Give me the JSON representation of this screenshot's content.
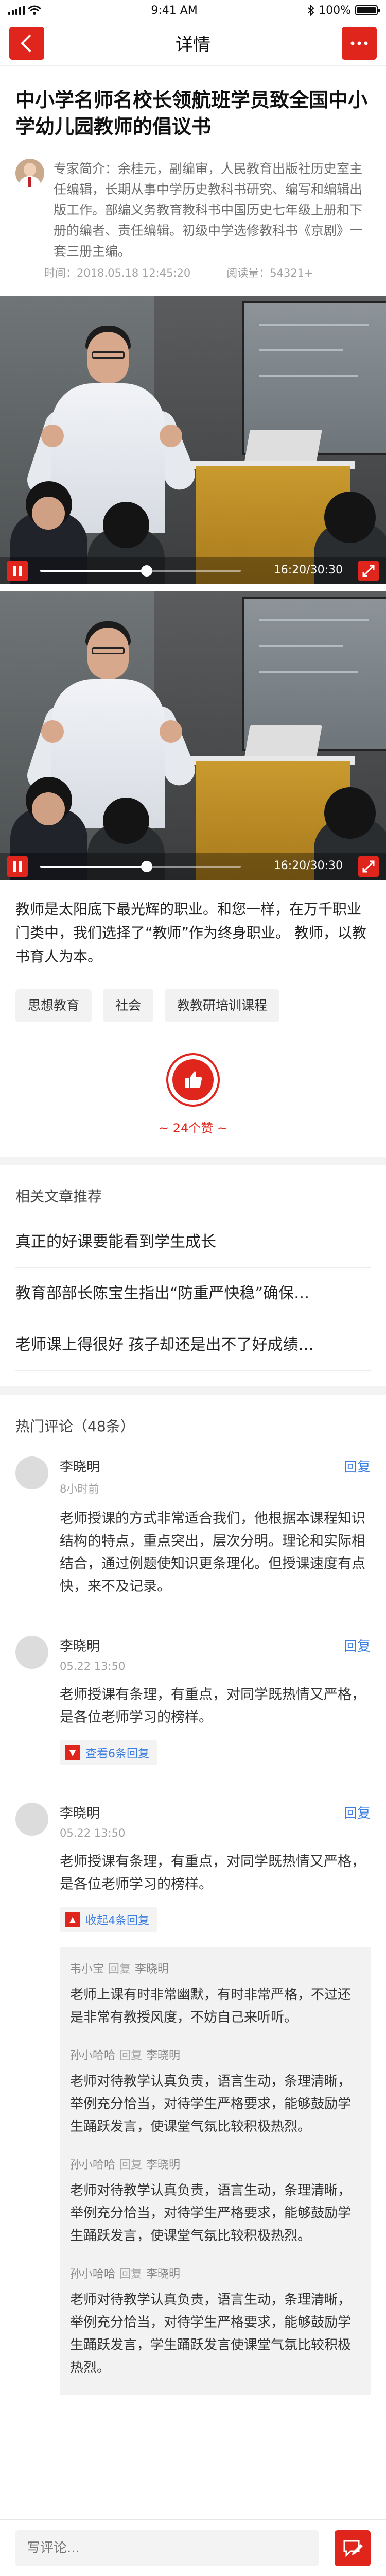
{
  "status_bar": {
    "time": "9:41 AM",
    "battery": "100%",
    "battery_level": 1.0
  },
  "nav": {
    "title": "详情",
    "back_icon": "chevron-left-icon",
    "more_icon": "more-dots-icon"
  },
  "article": {
    "title": "中小学名师名校长领航班学员致全国中小学幼儿园教师的倡议书",
    "author_intro": "专家简介：余桂元，副编审，人民教育出版社历史室主任编辑，长期从事中学历史教科书研究、编写和编辑出版工作。部编义务教育教科书中国历史七年级上册和下册的编者、责任编辑。初级中学选修教科书《京剧》一套三册主编。",
    "time": "时间：2018.05.18  12:45:20",
    "reads": "阅读量：54321+",
    "body": "教师是太阳底下最光辉的职业。和您一样，在万千职业门类中，我们选择了“教师”作为终身职业。 教师，以教书育人为本。"
  },
  "videos": [
    {
      "time": "16:20/30:30",
      "progress": 0.53
    },
    {
      "time": "16:20/30:30",
      "progress": 0.53
    }
  ],
  "tags": [
    "思想教育",
    "社会",
    "教教研培训课程"
  ],
  "like": {
    "count_text": "~ 24个赞 ~"
  },
  "recommend": {
    "title": "相关文章推荐",
    "items": [
      "真正的好课要能看到学生成长",
      "教育部部长陈宝生指出“防重严快稳”确保…",
      "老师课上得很好 孩子却还是出不了好成绩…"
    ]
  },
  "comments": {
    "title": "热门评论（48条）",
    "reply_label": "回复",
    "list": [
      {
        "name": "李晓明",
        "time": "8小时前",
        "text": "老师授课的方式非常适合我们，他根据本课程知识结构的特点，重点突出，层次分明。理论和实际相结合，通过例题使知识更条理化。但授课速度有点快，来不及记录。"
      },
      {
        "name": "李晓明",
        "time": "05.22 13:50",
        "text": "老师授课有条理，有重点，对同学既热情又严格，是各位老师学习的榜样。",
        "toggle": "查看6条回复"
      },
      {
        "name": "李晓明",
        "time": "05.22 13:50",
        "text": "老师授课有条理，有重点，对同学既热情又严格，是各位老师学习的榜样。",
        "toggle": "收起4条回复"
      }
    ],
    "replies": [
      {
        "from": "韦小宝",
        "kw": "回复",
        "to": "李晓明",
        "text": "老师上课有时非常幽默，有时非常严格，不过还是非常有教授风度，不妨自己来听听。"
      },
      {
        "from": "孙小哈哈",
        "kw": "回复",
        "to": "李晓明",
        "text": "老师对待教学认真负责，语言生动，条理清晰，举例充分恰当，对待学生严格要求，能够鼓励学生踊跃发言，使课堂气氛比较积极热烈。"
      },
      {
        "from": "孙小哈哈",
        "kw": "回复",
        "to": "李晓明",
        "text": "老师对待教学认真负责，语言生动，条理清晰，举例充分恰当，对待学生严格要求，能够鼓励学生踊跃发言，使课堂气氛比较积极热烈。"
      },
      {
        "from": "孙小哈哈",
        "kw": "回复",
        "to": "李晓明",
        "text": "老师对待教学认真负责，语言生动，条理清晰，举例充分恰当，对待学生严格要求，能够鼓励学生踊跃发言，学生踊跃发言使课堂气氛比较积极热烈。"
      }
    ]
  },
  "bottom": {
    "placeholder": "写评论..."
  },
  "colors": {
    "accent": "#e0251c",
    "link": "#3b7de0"
  }
}
